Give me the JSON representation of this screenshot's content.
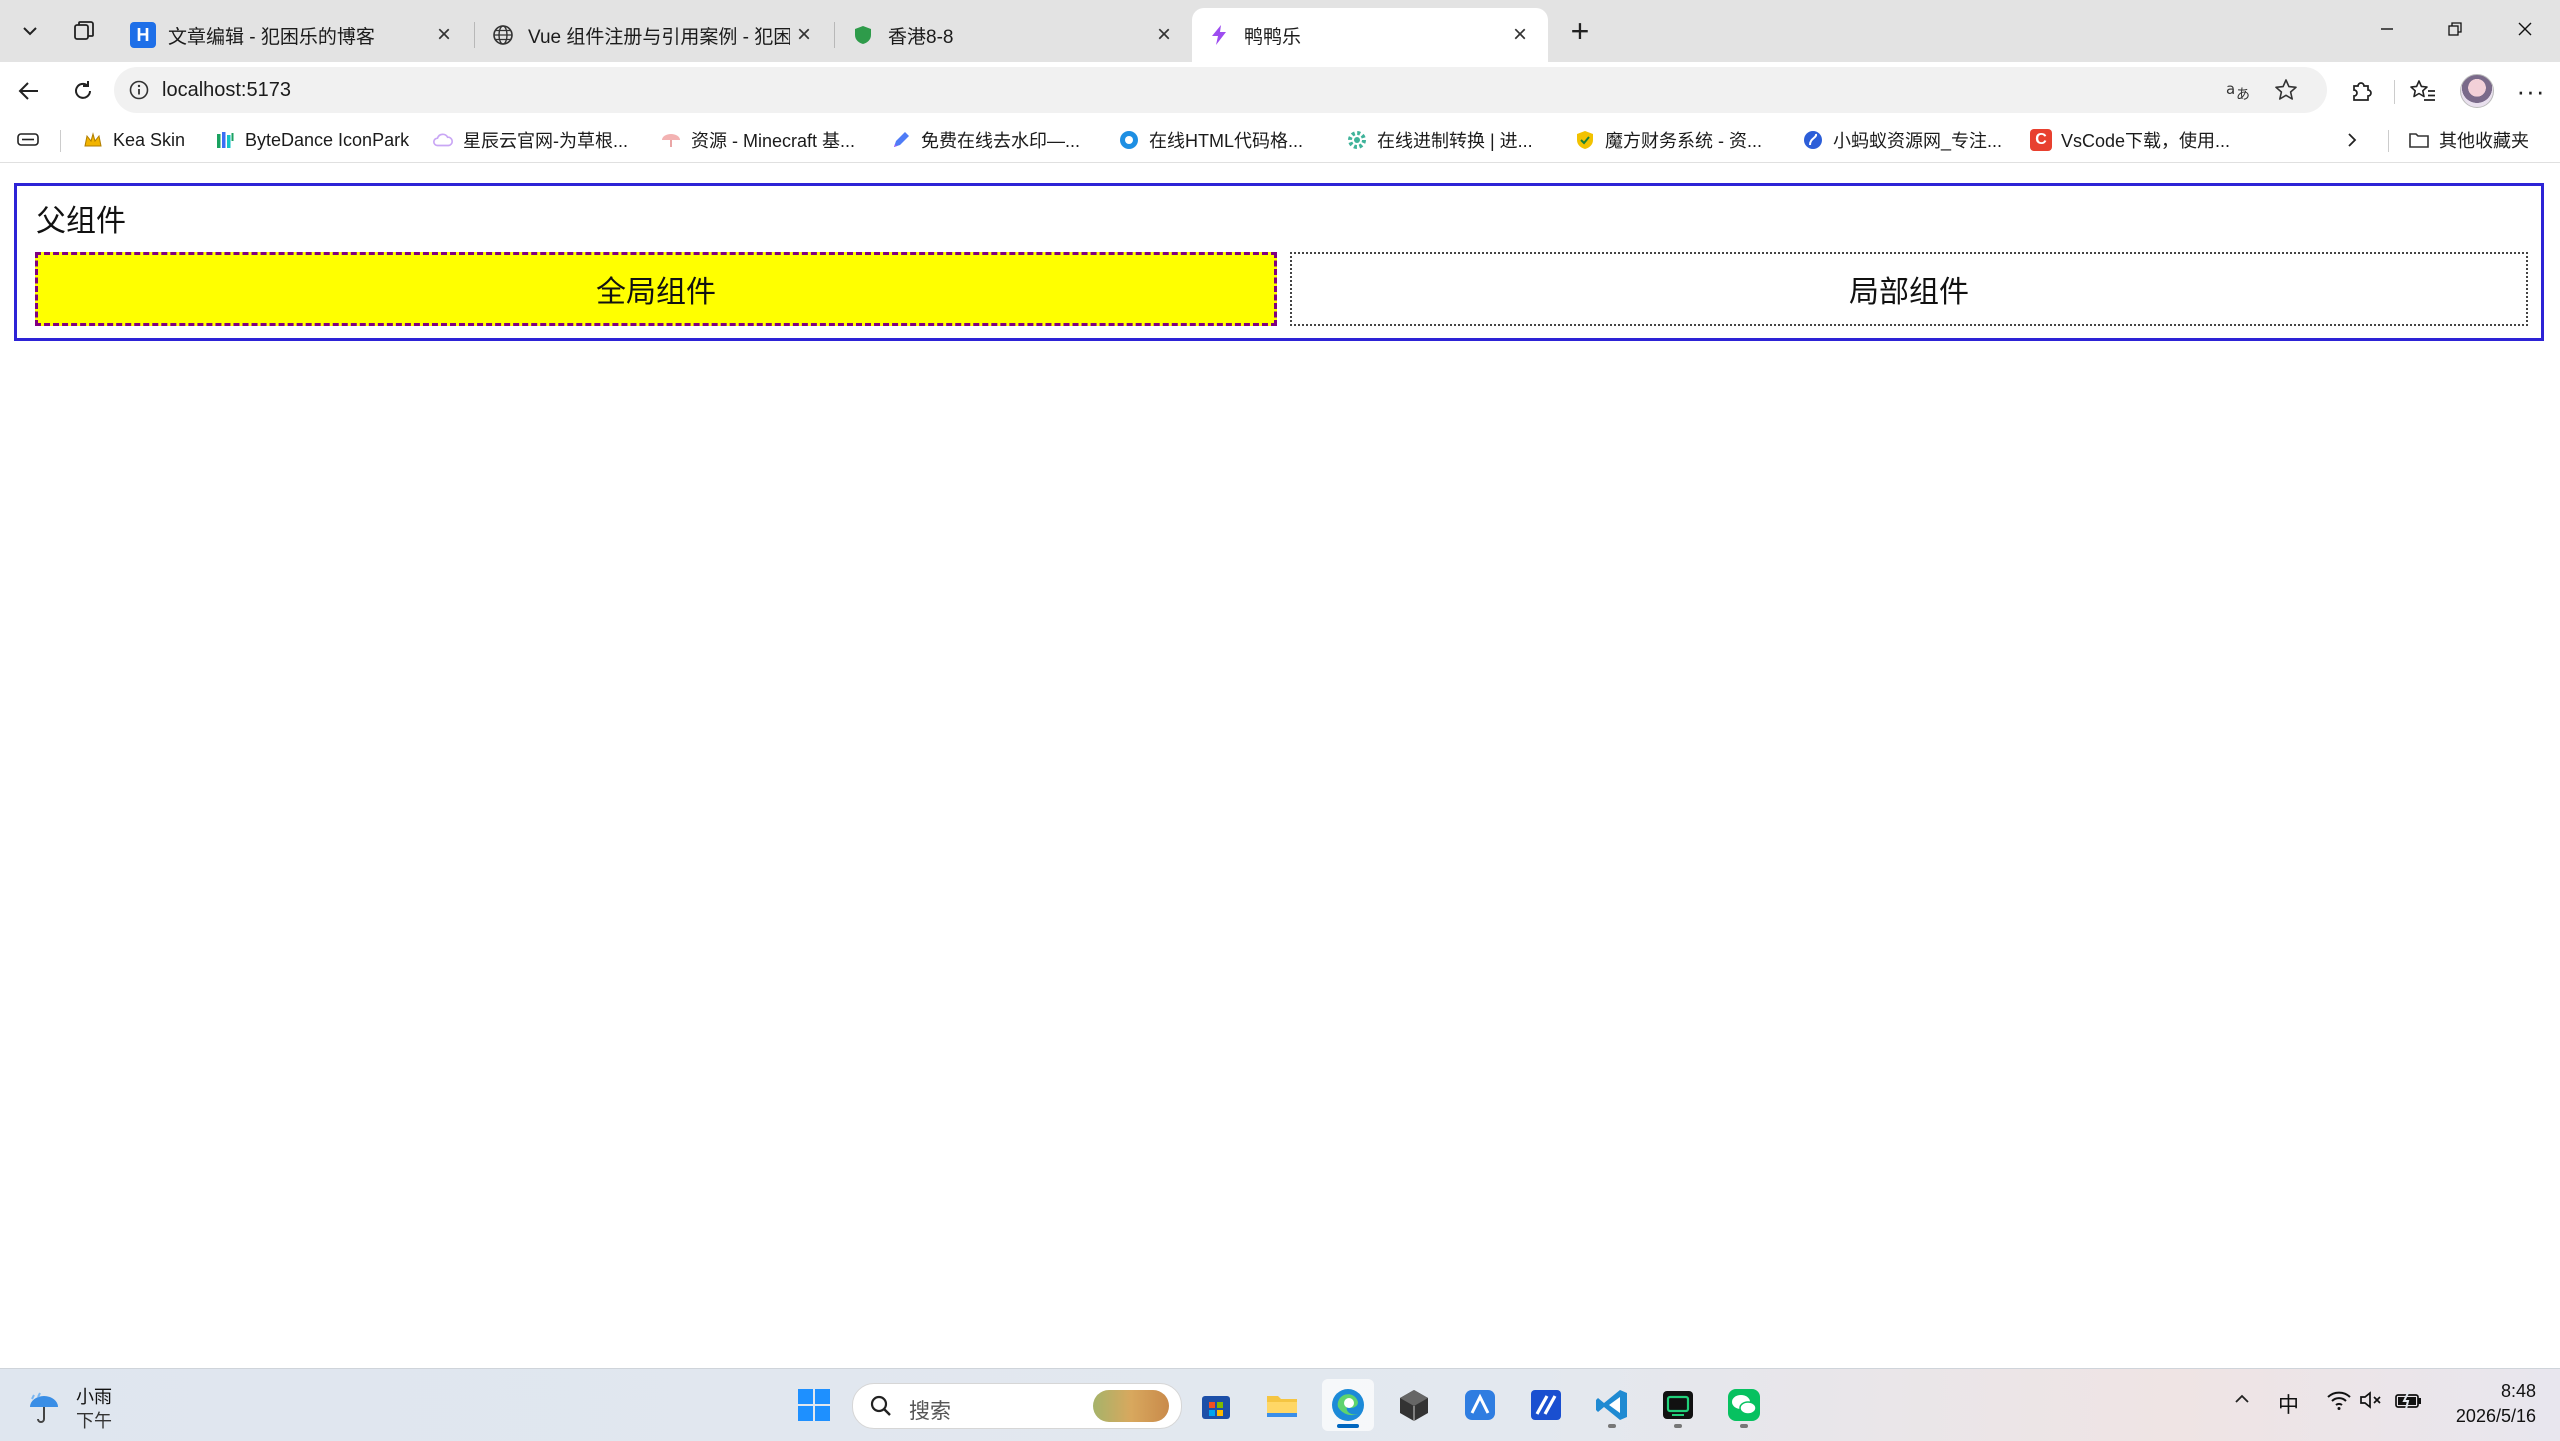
{
  "browser": {
    "tabs": [
      {
        "title": "文章编辑 - 犯困乐的博客",
        "favicon": "H",
        "active": false
      },
      {
        "title": "Vue 组件注册与引用案例 - 犯困乐",
        "favicon": "globe-icon",
        "active": false
      },
      {
        "title": "香港8-8",
        "favicon": "shield-icon",
        "active": false
      },
      {
        "title": "鸭鸭乐",
        "favicon": "bolt-icon",
        "active": true
      }
    ],
    "new_tab_label": "+",
    "address": "localhost:5173",
    "bookmarks": [
      {
        "label": "Kea Skin",
        "icon": "crown-icon"
      },
      {
        "label": "ByteDance IconPark",
        "icon": "iconpark-icon"
      },
      {
        "label": "星辰云官网-为草根...",
        "icon": "cloud-icon"
      },
      {
        "label": "资源 - Minecraft 基...",
        "icon": "umbrella-icon"
      },
      {
        "label": "免费在线去水印—...",
        "icon": "pen-icon"
      },
      {
        "label": "在线HTML代码格...",
        "icon": "circle-icon"
      },
      {
        "label": "在线进制转换 | 进...",
        "icon": "gear-icon"
      },
      {
        "label": "魔方财务系统 - 资...",
        "icon": "shield-check-icon"
      },
      {
        "label": "小蚂蚁资源网_专注...",
        "icon": "ant-icon"
      },
      {
        "label": "VsCode下载，使用...",
        "icon": "c-icon"
      }
    ],
    "other_bookmarks": "其他收藏夹"
  },
  "page": {
    "parent_title": "父组件",
    "global_component": "全局组件",
    "local_component": "局部组件"
  },
  "taskbar": {
    "weather_title": "小雨",
    "weather_sub": "下午",
    "search_placeholder": "搜索",
    "ime": "中",
    "time": "8:48",
    "date": "2026/5/16"
  },
  "colors": {
    "parent_border": "#2d23d6",
    "global_bg": "#ffff00",
    "global_border": "#800080"
  }
}
